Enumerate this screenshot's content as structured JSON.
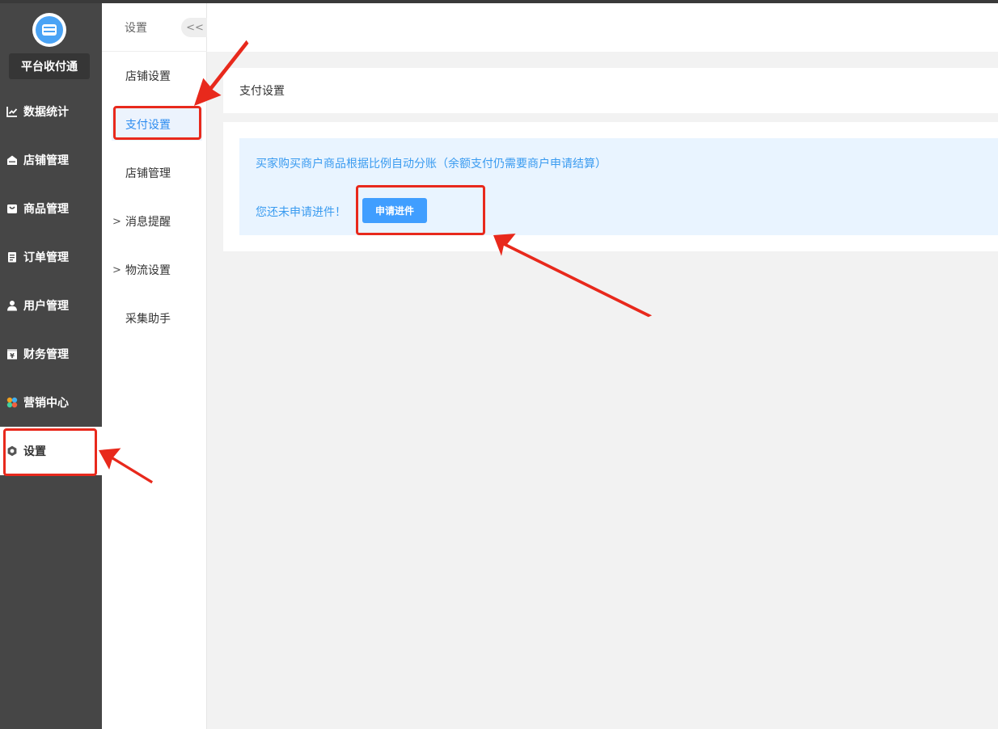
{
  "app": {
    "brand": "平台收付通"
  },
  "nav": {
    "items": [
      {
        "label": "数据统计",
        "icon": "chart-line-icon"
      },
      {
        "label": "店铺管理",
        "icon": "store-icon"
      },
      {
        "label": "商品管理",
        "icon": "bag-icon"
      },
      {
        "label": "订单管理",
        "icon": "clipboard-icon"
      },
      {
        "label": "用户管理",
        "icon": "user-icon"
      },
      {
        "label": "财务管理",
        "icon": "yen-icon"
      },
      {
        "label": "营销中心",
        "icon": "marketing-icon"
      },
      {
        "label": "设置",
        "icon": "gear-icon",
        "active": true
      }
    ]
  },
  "subnav": {
    "title": "设置",
    "collapse": "<<",
    "items": [
      {
        "label": "店铺设置"
      },
      {
        "label": "支付设置",
        "active": true
      },
      {
        "label": "店铺管理"
      },
      {
        "label": "消息提醒",
        "expandable": true
      },
      {
        "label": "物流设置",
        "expandable": true
      },
      {
        "label": "采集助手"
      }
    ]
  },
  "main": {
    "page_title": "支付设置",
    "notice_text": "买家购买商户商品根据比例自动分账（余额支付仍需要商户申请结算）",
    "status_text": "您还未申请进件！",
    "apply_button": "申请进件"
  },
  "colors": {
    "accent": "#409eff",
    "nav_bg": "#464646",
    "annotation": "#e8291c"
  }
}
